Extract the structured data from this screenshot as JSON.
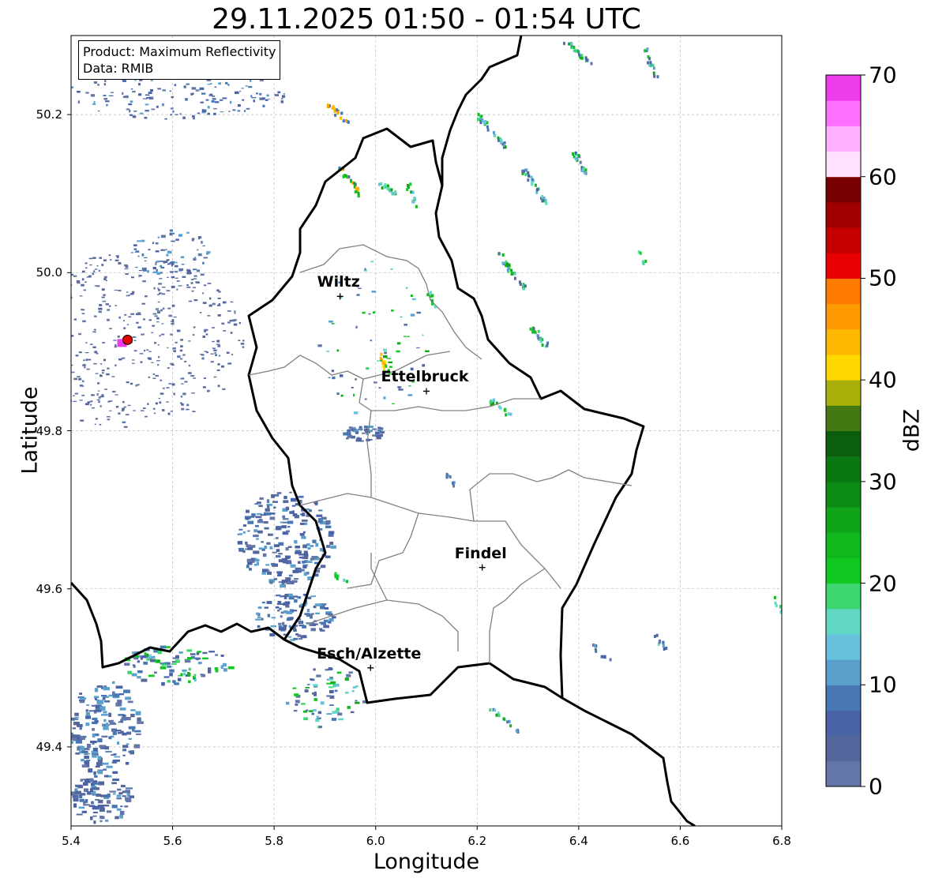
{
  "title": "29.11.2025 01:50 - 01:54 UTC",
  "info": {
    "product_line": "Product: Maximum Reflectivity",
    "data_line": "Data: RMIB"
  },
  "axes": {
    "xlabel": "Longitude",
    "ylabel": "Latitude",
    "xlim": [
      5.4,
      6.8
    ],
    "ylim": [
      49.3,
      50.3
    ],
    "xticks": [
      "5.4",
      "5.6",
      "5.8",
      "6.0",
      "6.2",
      "6.4",
      "6.6",
      "6.8"
    ],
    "yticks": [
      "49.4",
      "49.6",
      "49.8",
      "50.0",
      "50.2"
    ],
    "grid": true
  },
  "cities": [
    {
      "name": "Wiltz",
      "lon": 5.93,
      "lat": 49.97
    },
    {
      "name": "Ettelbruck",
      "lon": 6.1,
      "lat": 49.85
    },
    {
      "name": "Findel",
      "lon": 6.21,
      "lat": 49.627
    },
    {
      "name": "Esch/Alzette",
      "lon": 5.99,
      "lat": 49.5
    }
  ],
  "radar_site": {
    "lon": 5.505,
    "lat": 49.915
  },
  "colorbar": {
    "label": "dBZ",
    "ticks": [
      "0",
      "10",
      "20",
      "30",
      "40",
      "50",
      "60",
      "70"
    ],
    "colors": [
      "#6276a8",
      "#54689e",
      "#4a62a6",
      "#4878b4",
      "#5aa0cc",
      "#66c2dc",
      "#60d8c4",
      "#3ed66e",
      "#10c820",
      "#10b81c",
      "#10a418",
      "#0c8c14",
      "#0a7812",
      "#0a5e0c",
      "#447810",
      "#aab00a",
      "#ffd800",
      "#ffb800",
      "#ff9a00",
      "#ff7a00",
      "#e80000",
      "#c60000",
      "#a00000",
      "#780000",
      "#ffe0ff",
      "#ffb0ff",
      "#ff70ff",
      "#ec3cec"
    ]
  }
}
